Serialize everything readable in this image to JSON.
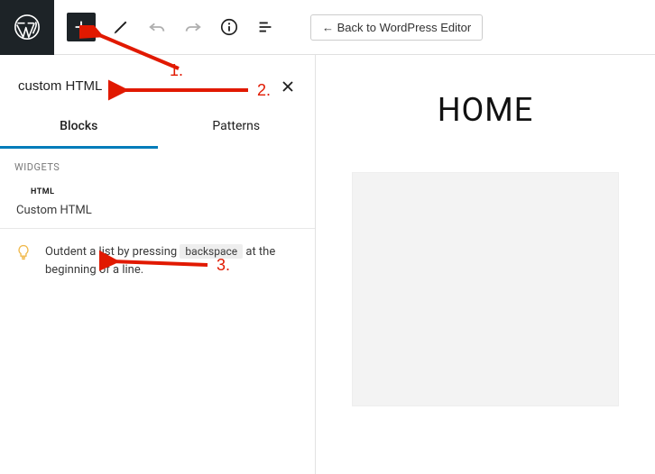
{
  "colors": {
    "accent": "#007cba",
    "annotation": "#e11900"
  },
  "topbar": {
    "back_label": "← Back to WordPress Editor"
  },
  "search": {
    "value": "custom HTML"
  },
  "tabs": {
    "blocks": "Blocks",
    "patterns": "Patterns",
    "active": "blocks"
  },
  "section": "Widgets",
  "block": {
    "badge": "HTML",
    "name": "Custom HTML"
  },
  "tip": {
    "pre": "Outdent a list by pressing ",
    "kbd": "backspace",
    "post": " at the beginning of a line."
  },
  "canvas": {
    "title": "HOME"
  },
  "annotations": {
    "a1": "1.",
    "a2": "2.",
    "a3": "3."
  }
}
